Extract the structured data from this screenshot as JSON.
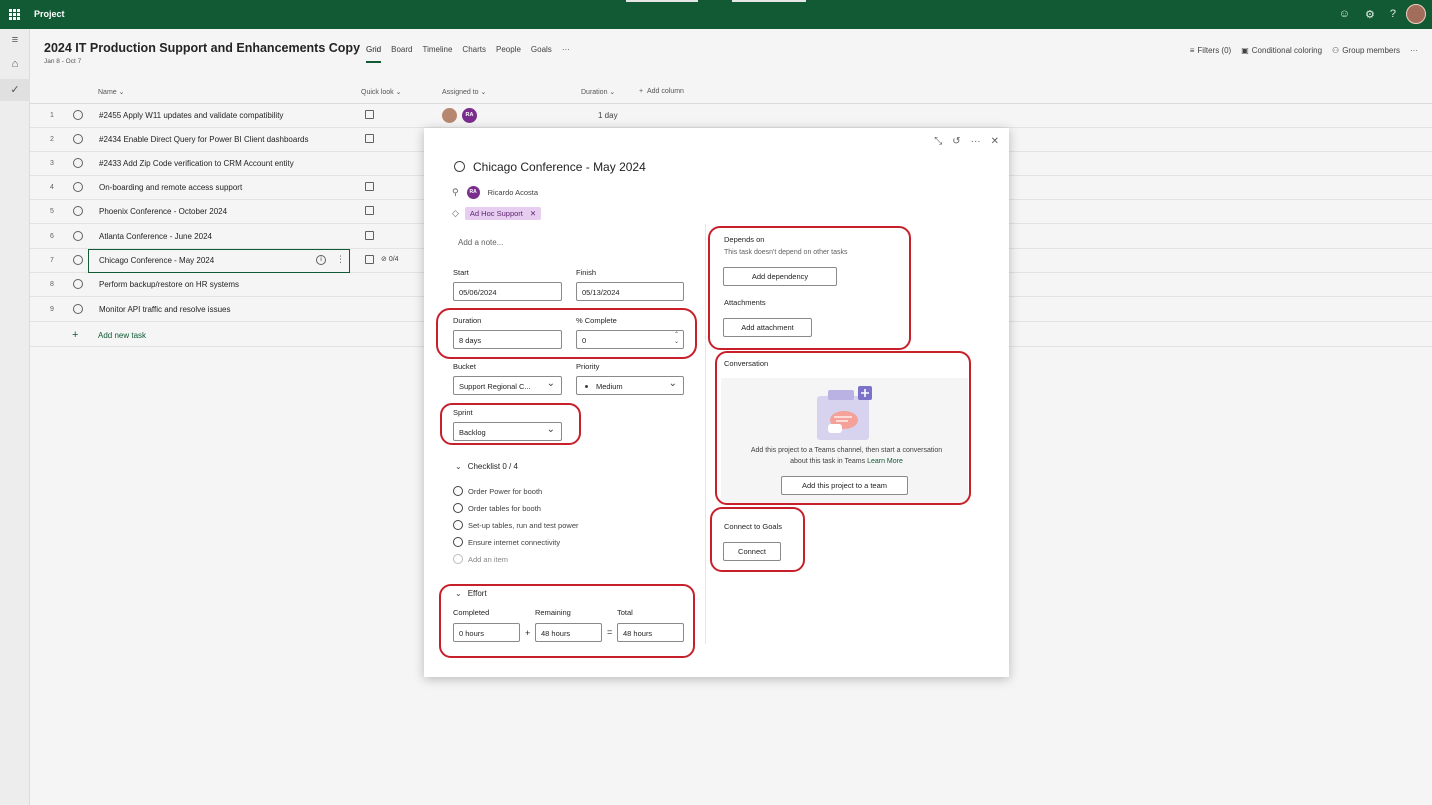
{
  "app": {
    "name": "Project"
  },
  "project": {
    "title": "2024 IT Production Support and Enhancements Copy",
    "dates": "Jan 8 - Oct 7",
    "views": [
      "Grid",
      "Board",
      "Timeline",
      "Charts",
      "People",
      "Goals",
      "···"
    ],
    "selected_view": "Grid"
  },
  "header_actions": {
    "filters": "Filters (0)",
    "conditional_coloring": "Conditional coloring",
    "group_members": "Group members",
    "more": "···"
  },
  "grid": {
    "columns": {
      "name": "Name",
      "quick_look": "Quick look",
      "assigned_to": "Assigned to",
      "duration": "Duration",
      "add_column": "Add column"
    },
    "rows": [
      {
        "num": "1",
        "name": "#2455 Apply W11 updates and validate compatibility",
        "duration": "1 day",
        "assignee_initials": "RA"
      },
      {
        "num": "2",
        "name": "#2434 Enable Direct Query for Power BI Client dashboards"
      },
      {
        "num": "3",
        "name": "#2433 Add Zip Code verification to CRM Account entity"
      },
      {
        "num": "4",
        "name": "On-boarding and remote access support"
      },
      {
        "num": "5",
        "name": "Phoenix Conference - October 2024"
      },
      {
        "num": "6",
        "name": "Atlanta Conference - June 2024"
      },
      {
        "num": "7",
        "name": "Chicago Conference - May 2024",
        "checklist": "0/4"
      },
      {
        "num": "8",
        "name": "Perform backup/restore on HR systems"
      },
      {
        "num": "9",
        "name": "Monitor API traffic and resolve issues"
      }
    ],
    "add_new_task": "Add new task"
  },
  "task": {
    "title": "Chicago Conference - May 2024",
    "assignee": {
      "initials": "RA",
      "name": "Ricardo Acosta"
    },
    "label": "Ad Hoc Support",
    "note_placeholder": "Add a note...",
    "start": {
      "label": "Start",
      "value": "05/06/2024"
    },
    "finish": {
      "label": "Finish",
      "value": "05/13/2024"
    },
    "duration": {
      "label": "Duration",
      "value": "8 days"
    },
    "percent_complete": {
      "label": "% Complete",
      "value": "0"
    },
    "bucket": {
      "label": "Bucket",
      "value": "Support Regional C..."
    },
    "priority": {
      "label": "Priority",
      "value": "Medium"
    },
    "sprint": {
      "label": "Sprint",
      "value": "Backlog"
    },
    "checklist": {
      "header": "Checklist 0 / 4",
      "items": [
        "Order Power for booth",
        "Order tables for booth",
        "Set-up tables, run and test power",
        "Ensure internet connectivity"
      ],
      "add_item": "Add an item"
    },
    "effort": {
      "header": "Effort",
      "completed": {
        "label": "Completed",
        "value": "0 hours"
      },
      "remaining": {
        "label": "Remaining",
        "value": "48 hours"
      },
      "total": {
        "label": "Total",
        "value": "48 hours"
      },
      "plus": "+",
      "equals": "="
    },
    "depends_on": {
      "title": "Depends on",
      "subtitle": "This task doesn't depend on other tasks",
      "button": "Add dependency"
    },
    "attachments": {
      "title": "Attachments",
      "button": "Add attachment"
    },
    "conversation": {
      "title": "Conversation",
      "text": "Add this project to a Teams channel, then start a conversation about this task in Teams",
      "learn_more": "Learn More",
      "button": "Add this project to a team"
    },
    "goals": {
      "title": "Connect to Goals",
      "button": "Connect"
    }
  },
  "colors": {
    "brand": "#115a34",
    "annotation": "#c8202b",
    "label_bg": "#e7cdf0"
  }
}
